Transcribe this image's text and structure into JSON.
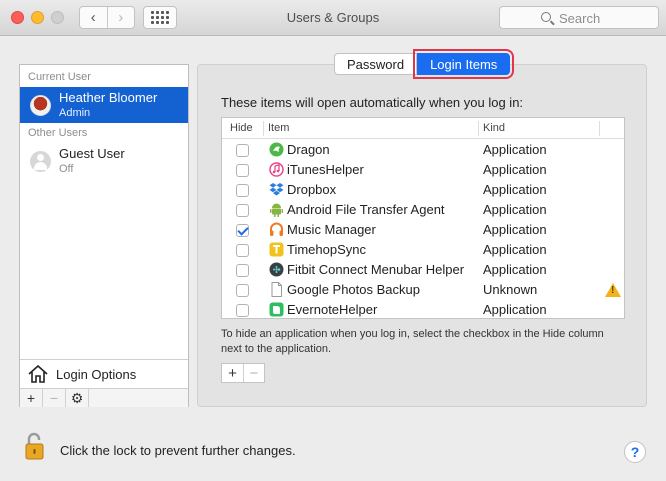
{
  "window": {
    "title": "Users & Groups",
    "search_placeholder": "Search"
  },
  "sidebar": {
    "current_header": "Current User",
    "other_header": "Other Users",
    "users": [
      {
        "name": "Heather Bloomer",
        "role": "Admin",
        "selected": true
      },
      {
        "name": "Guest User",
        "role": "Off",
        "selected": false
      }
    ],
    "login_options_label": "Login Options",
    "toolbar": {
      "add": "+",
      "remove": "−",
      "gear": "⚙"
    }
  },
  "tabs": [
    {
      "label": "Password",
      "active": false
    },
    {
      "label": "Login Items",
      "active": true
    }
  ],
  "login_items": {
    "intro": "These items will open automatically when you log in:",
    "columns": {
      "hide": "Hide",
      "item": "Item",
      "kind": "Kind"
    },
    "rows": [
      {
        "name": "Dragon",
        "kind": "Application",
        "hidden": false,
        "icon": "dragon-icon",
        "color": "#4db848"
      },
      {
        "name": "iTunesHelper",
        "kind": "Application",
        "hidden": false,
        "icon": "itunes-icon",
        "color": "#e8468c"
      },
      {
        "name": "Dropbox",
        "kind": "Application",
        "hidden": false,
        "icon": "dropbox-icon",
        "color": "#2a7de1"
      },
      {
        "name": "Android File Transfer Agent",
        "kind": "Application",
        "hidden": false,
        "icon": "android-icon",
        "color": "#86b640"
      },
      {
        "name": "Music Manager",
        "kind": "Application",
        "hidden": true,
        "icon": "headphones-icon",
        "color": "#f07b22"
      },
      {
        "name": "TimehopSync",
        "kind": "Application",
        "hidden": false,
        "icon": "timehop-icon",
        "color": "#f2c21b"
      },
      {
        "name": "Fitbit Connect Menubar Helper",
        "kind": "Application",
        "hidden": false,
        "icon": "fitbit-icon",
        "color": "#3a3f44"
      },
      {
        "name": "Google Photos Backup",
        "kind": "Unknown",
        "hidden": false,
        "icon": "document-icon",
        "color": "#ffffff",
        "warning": true
      },
      {
        "name": "EvernoteHelper",
        "kind": "Application",
        "hidden": false,
        "icon": "evernote-icon",
        "color": "#2dbe60"
      }
    ],
    "note": "To hide an application when you log in, select the checkbox in the Hide column next to the application.",
    "toolbar": {
      "add": "+",
      "remove": "−"
    }
  },
  "footer": {
    "lock_text": "Click the lock to prevent further changes.",
    "help": "?"
  }
}
